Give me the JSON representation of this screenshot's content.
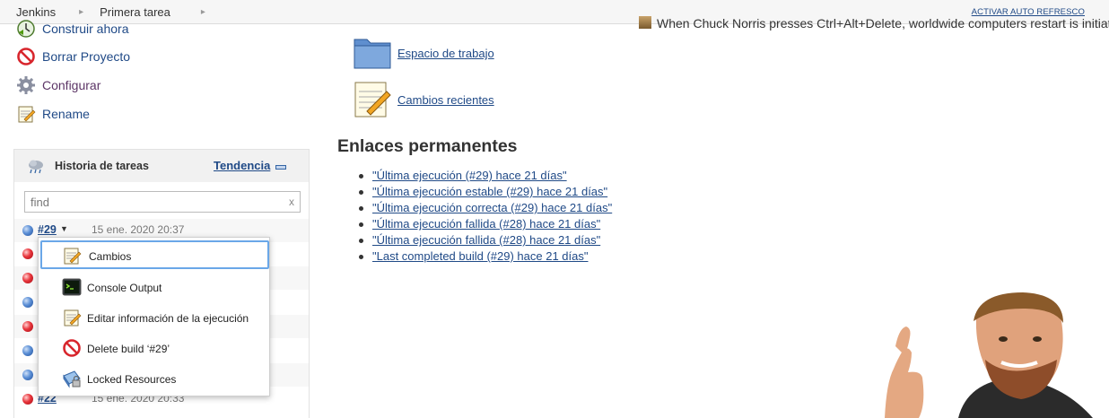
{
  "breadcrumb": {
    "items": [
      "Jenkins",
      "Primera tarea"
    ],
    "separator": "▸",
    "autorefresh": "ACTIVAR AUTO REFRESCO"
  },
  "quote": "When Chuck Norris presses Ctrl+Alt+Delete, worldwide computers restart is initiated.",
  "sidebar": {
    "tasks": [
      {
        "label": "Construir ahora",
        "icon": "build-clock-icon"
      },
      {
        "label": "Borrar Proyecto",
        "icon": "no-entry-icon"
      },
      {
        "label": "Configurar",
        "icon": "gear-icon"
      },
      {
        "label": "Rename",
        "icon": "notepad-icon"
      }
    ]
  },
  "history": {
    "title": "Historia de tareas",
    "trend": "Tendencia",
    "search_placeholder": "find",
    "search_clear": "x",
    "builds": [
      {
        "number": "#29",
        "date": "15 ene. 2020 20:37",
        "status": "blue"
      },
      {
        "number": "",
        "date": "",
        "status": "red"
      },
      {
        "number": "",
        "date": "",
        "status": "red"
      },
      {
        "number": "",
        "date": "",
        "status": "blue"
      },
      {
        "number": "",
        "date": "",
        "status": "red"
      },
      {
        "number": "",
        "date": "",
        "status": "blue"
      },
      {
        "number": "",
        "date": "",
        "status": "blue"
      },
      {
        "number": "#22",
        "date": "15 ene. 2020 20:33",
        "status": "red"
      }
    ]
  },
  "context_menu": {
    "items": [
      {
        "label": "Cambios",
        "icon": "notepad-icon"
      },
      {
        "label": "Console Output",
        "icon": "terminal-icon"
      },
      {
        "label": "Editar información de la ejecución",
        "icon": "notepad-icon"
      },
      {
        "label": "Delete build ‘#29’",
        "icon": "no-entry-icon"
      },
      {
        "label": "Locked Resources",
        "icon": "lock-resource-icon"
      }
    ]
  },
  "main": {
    "workspace": "Espacio de trabajo",
    "recent_changes": "Cambios recientes",
    "permalinks_title": "Enlaces permanentes",
    "permalinks": [
      "\"Última ejecución (#29) hace 21 días\"",
      "\"Última ejecución estable (#29) hace 21 días\"",
      "\"Última ejecución correcta (#29) hace 21 días\"",
      "\"Última ejecución fallida (#28) hace 21 días\"",
      "\"Última ejecución fallida (#28) hace 21 días\"",
      "\"Last completed build (#29) hace 21 días\""
    ]
  },
  "colors": {
    "link": "#204a87",
    "visited_link": "#5c3566",
    "menu_focus": "#6aa7e8",
    "status_blue": "#3b73c4",
    "status_red": "#d8262d"
  }
}
